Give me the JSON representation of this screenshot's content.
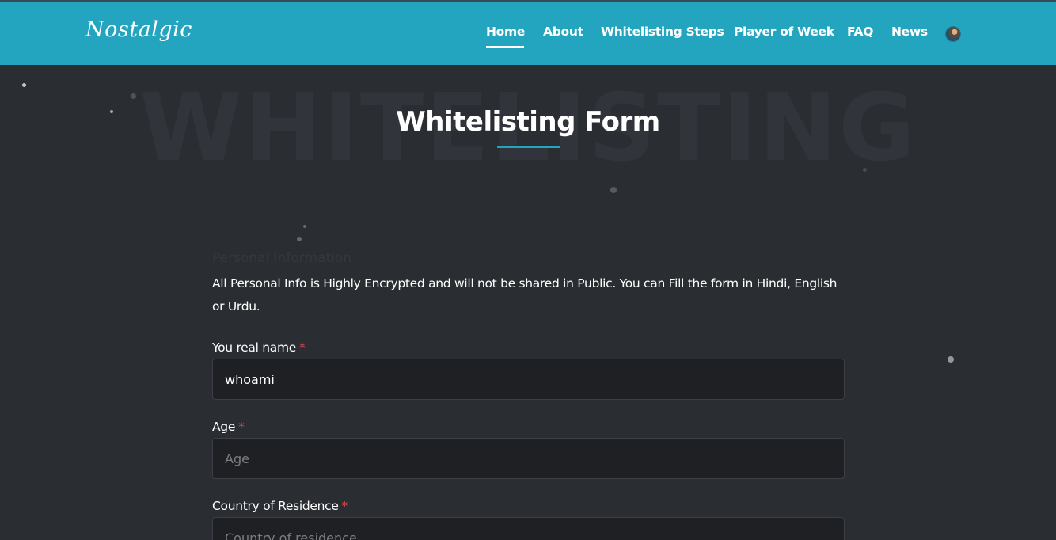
{
  "header": {
    "brand": "Nostalgic",
    "nav": [
      {
        "label": "Home",
        "active": true
      },
      {
        "label": "About"
      },
      {
        "label": "Whitelisting Steps"
      },
      {
        "label": "Player of Week"
      },
      {
        "label": "FAQ"
      },
      {
        "label": "News"
      }
    ],
    "avatar_icon": "user-avatar-icon",
    "accent_color": "#23a5c0"
  },
  "hero": {
    "watermark": "WHITELISTING",
    "title": "Whitelisting Form"
  },
  "form": {
    "section_heading": "Personal Information",
    "note": "All Personal Info is Highly Encrypted and will not be shared in Public. You can Fill the form in Hindi, English or Urdu.",
    "required_mark": "*",
    "fields": [
      {
        "label": "You real name",
        "value": "whoami",
        "placeholder": ""
      },
      {
        "label": "Age",
        "value": "",
        "placeholder": "Age"
      },
      {
        "label": "Country of Residence",
        "value": "",
        "placeholder": "Country of residence"
      }
    ]
  }
}
